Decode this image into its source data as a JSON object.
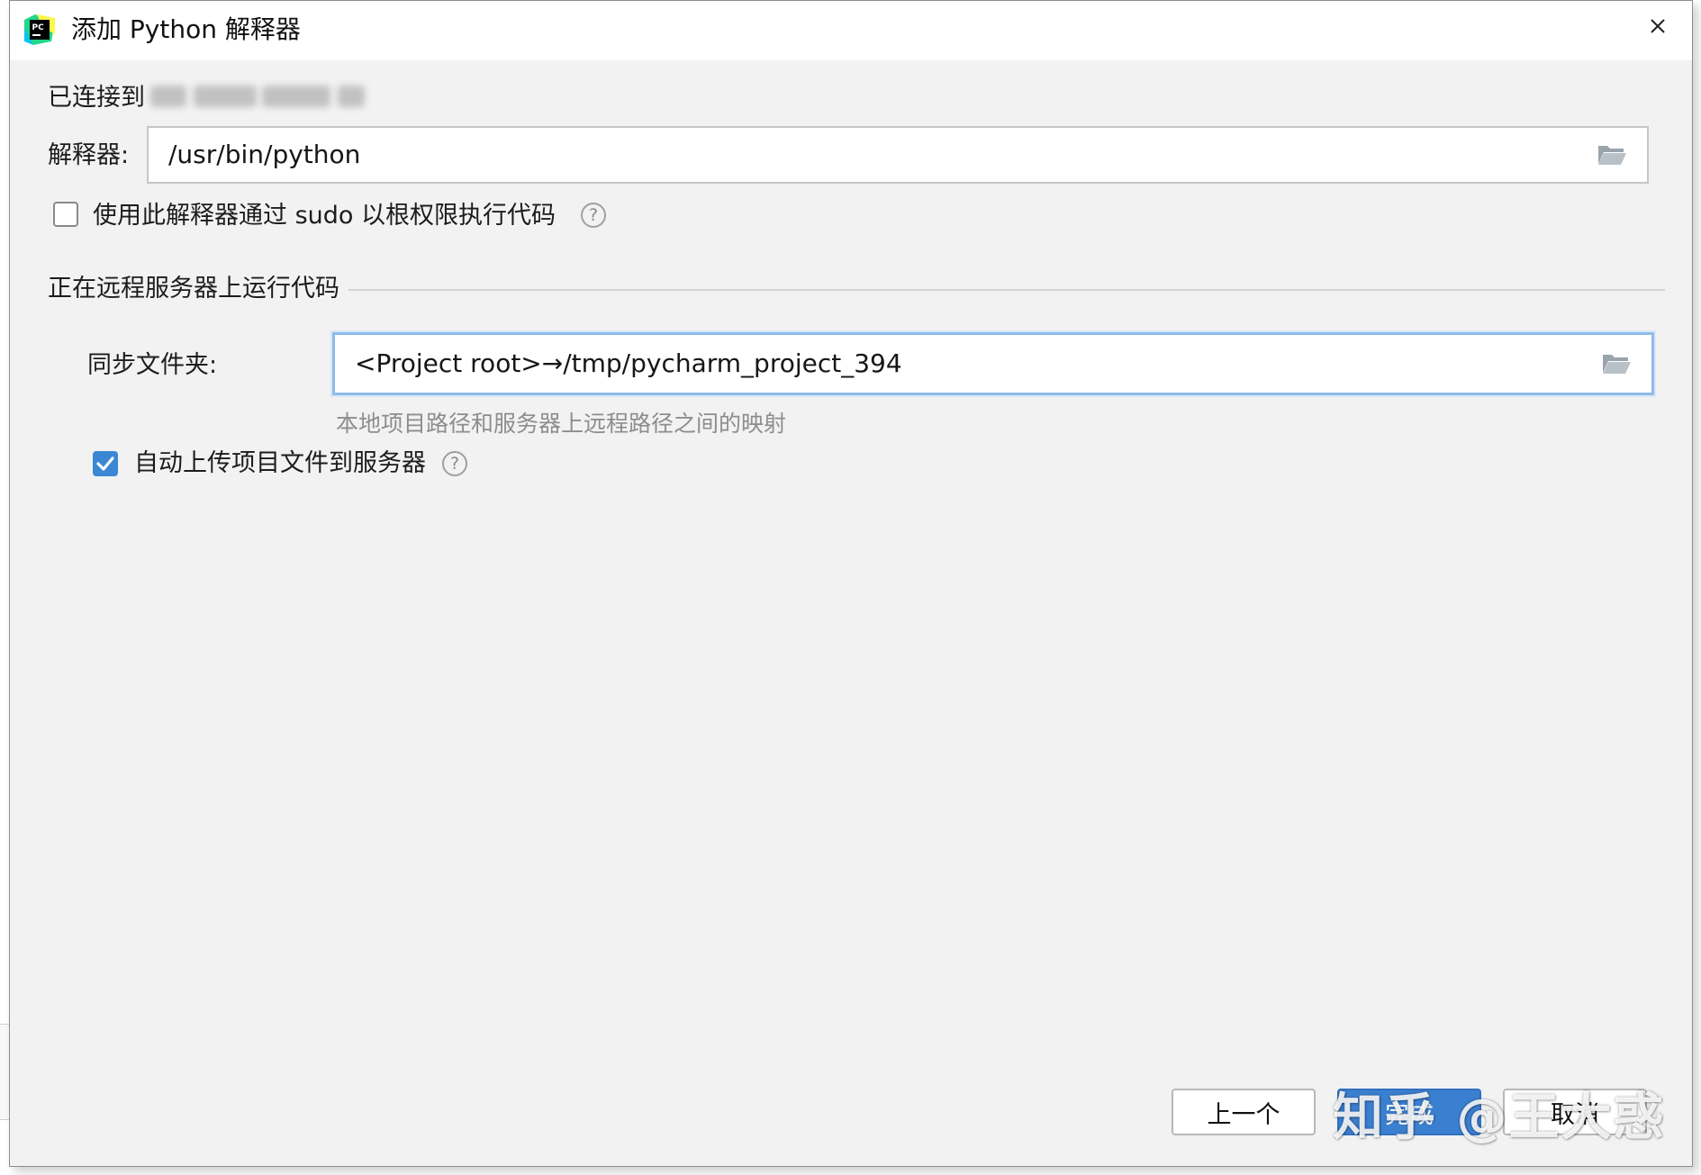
{
  "window": {
    "title": "添加 Python 解释器"
  },
  "connection": {
    "label": "已连接到"
  },
  "interpreter": {
    "label": "解释器:",
    "value": "/usr/bin/python"
  },
  "sudo_option": {
    "label": "使用此解释器通过 sudo 以根权限执行代码",
    "checked": false
  },
  "remote_section": {
    "title": "正在远程服务器上运行代码"
  },
  "sync_folder": {
    "label": "同步文件夹:",
    "value": "<Project root>→/tmp/pycharm_project_394",
    "hint": "本地项目路径和服务器上远程路径之间的映射"
  },
  "auto_upload": {
    "label": "自动上传项目文件到服务器",
    "checked": true
  },
  "buttons": {
    "previous": "上一个",
    "finish": "完成",
    "cancel": "取消"
  },
  "watermark": {
    "text": "知乎 @王大惑"
  },
  "colors": {
    "accent": "#3b7fd0",
    "checkbox_checked": "#3b87d4",
    "focus_border": "#8fbce8",
    "dialog_bg": "#f2f2f2"
  },
  "icons": {
    "app": "pycharm-icon",
    "close": "close-icon",
    "browse": "folder-open-icon",
    "help": "question-mark-icon"
  }
}
